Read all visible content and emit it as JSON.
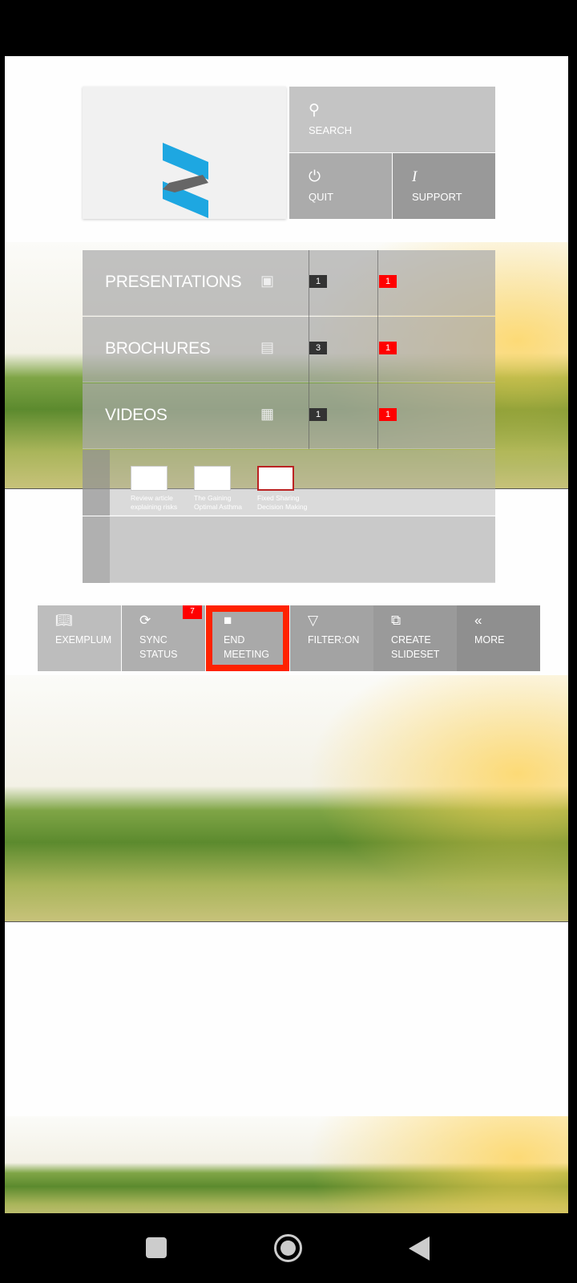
{
  "header": {
    "search_label": "SEARCH",
    "quit_label": "QUIT",
    "support_label": "SUPPORT"
  },
  "categories": [
    {
      "label": "PRESENTATIONS",
      "icon": "presentation-icon",
      "count": "1",
      "new": "1"
    },
    {
      "label": "BROCHURES",
      "icon": "document-icon",
      "count": "3",
      "new": "1"
    },
    {
      "label": "VIDEOS",
      "icon": "film-icon",
      "count": "1",
      "new": "1"
    }
  ],
  "thumbnails": [
    {
      "caption1": "Review article",
      "caption2": "explaining risks"
    },
    {
      "caption1": "The Gaining",
      "caption2": "Optimal Asthma"
    },
    {
      "caption1": "Fixed Sharing",
      "caption2": "Decision Making"
    }
  ],
  "toolbar": [
    {
      "label": "EXEMPLUM",
      "icon": "book-icon"
    },
    {
      "label": "SYNC STATUS",
      "icon": "sync-icon",
      "badge": "7"
    },
    {
      "label": "END MEETING",
      "icon": "stop-icon"
    },
    {
      "label": "FILTER:ON",
      "icon": "filter-icon"
    },
    {
      "label": "CREATE",
      "label2": "SLIDESET",
      "icon": "slides-icon"
    },
    {
      "label": "MORE",
      "icon": "double-chevron-left-icon"
    }
  ],
  "colors": {
    "accent": "#1ea7e1",
    "badge": "#ff0000",
    "highlight": "#ff2200"
  }
}
